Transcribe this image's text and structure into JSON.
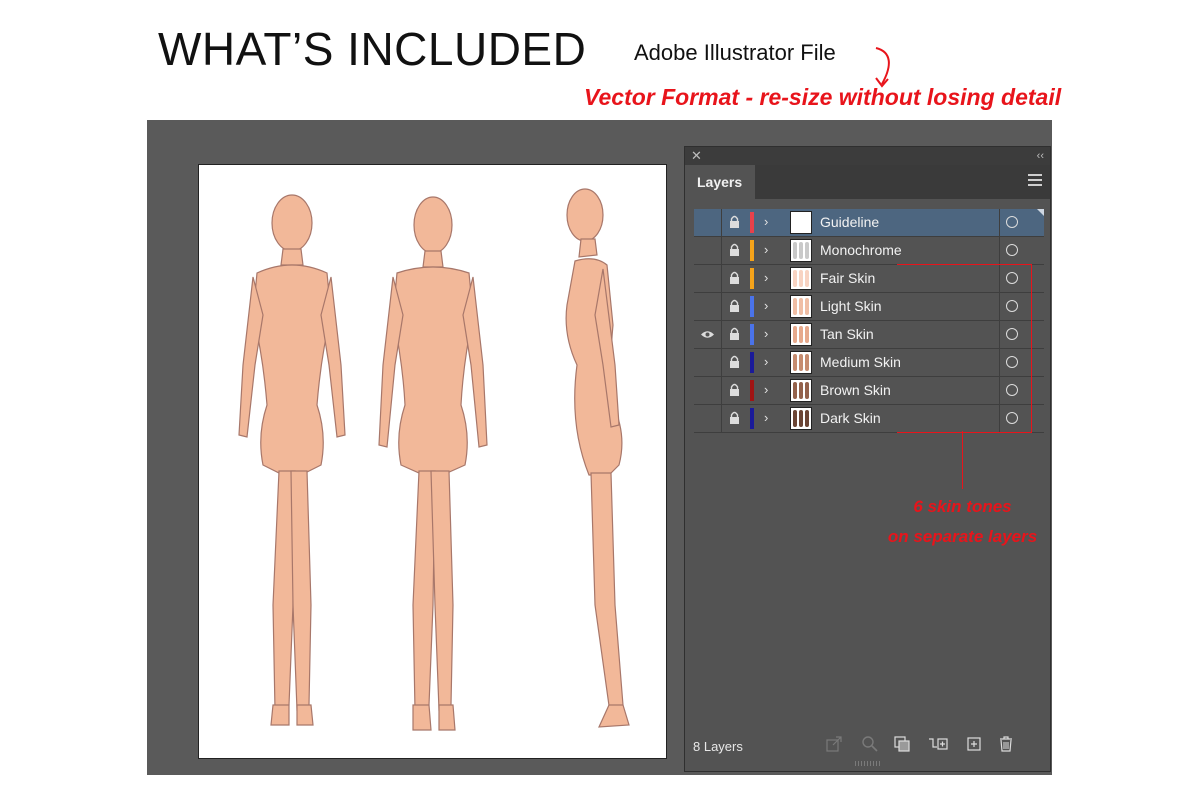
{
  "header": {
    "title": "WHAT’S INCLUDED",
    "file_type": "Adobe Illustrator File",
    "format_note": "Vector Format - re-size without losing detail"
  },
  "colors": {
    "accent_red": "#e8141b",
    "workspace_bg": "#5a5a5a",
    "panel_bg": "#535353",
    "selected_row": "#4d6680",
    "skin": "#f2b899",
    "skin_outline": "#a8776a"
  },
  "layers_panel": {
    "tab_label": "Layers",
    "close_glyph": "✕",
    "collapse_glyph": "‹‹",
    "layers": [
      {
        "name": "Guideline",
        "color": "#e8414b",
        "visible": false,
        "selected": true,
        "thumb": "blank"
      },
      {
        "name": "Monochrome",
        "color": "#f5a31a",
        "visible": false,
        "selected": false,
        "thumb": "#c9c9c9"
      },
      {
        "name": "Fair Skin",
        "color": "#f5a31a",
        "visible": false,
        "selected": false,
        "thumb": "#f8d3c2"
      },
      {
        "name": "Light Skin",
        "color": "#4a73ea",
        "visible": false,
        "selected": false,
        "thumb": "#f0bea5"
      },
      {
        "name": "Tan Skin",
        "color": "#4a73ea",
        "visible": true,
        "selected": false,
        "thumb": "#e6a98c"
      },
      {
        "name": "Medium Skin",
        "color": "#1a1a99",
        "visible": false,
        "selected": false,
        "thumb": "#c68c70"
      },
      {
        "name": "Brown Skin",
        "color": "#a01414",
        "visible": false,
        "selected": false,
        "thumb": "#94614b"
      },
      {
        "name": "Dark Skin",
        "color": "#1a1a99",
        "visible": false,
        "selected": false,
        "thumb": "#6b4434"
      }
    ],
    "layer_count": "8 Layers"
  },
  "annotation": {
    "line1": "6 skin tones",
    "line2": "on separate layers"
  }
}
